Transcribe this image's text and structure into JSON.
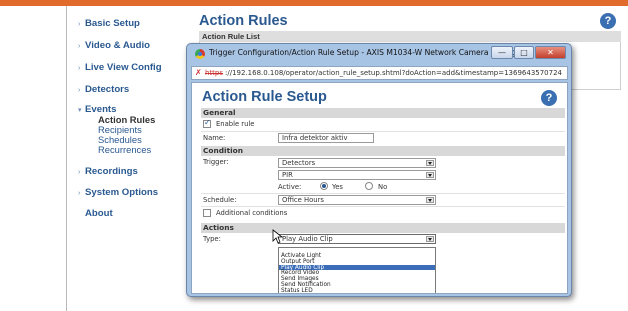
{
  "nav": {
    "items": [
      {
        "label": "Basic Setup",
        "caret": "›"
      },
      {
        "label": "Video & Audio",
        "caret": "›"
      },
      {
        "label": "Live View Config",
        "caret": "›"
      },
      {
        "label": "Detectors",
        "caret": "›"
      },
      {
        "label": "Events",
        "caret": "▾"
      },
      {
        "label": "Recordings",
        "caret": "›"
      },
      {
        "label": "System Options",
        "caret": "›"
      },
      {
        "label": "About",
        "caret": ""
      }
    ],
    "events_sub": [
      "Action Rules",
      "Recipients",
      "Schedules",
      "Recurrences"
    ]
  },
  "background": {
    "title": "Action Rules",
    "list_header": "Action Rule List",
    "help": "?"
  },
  "window": {
    "title": "Trigger Configuration/Action Rule Setup - AXIS M1034-W Network Camera - Googl...",
    "url_scheme": "https",
    "url_rest": "://192.168.0.108/operator/action_rule_setup.shtml?doAction=add&timestamp=1369643570724",
    "minimize": "—",
    "maximize": "□",
    "close": "✕"
  },
  "form": {
    "title": "Action Rule Setup",
    "help": "?",
    "general_label": "General",
    "enable_rule_label": "Enable rule",
    "enable_rule_checked": true,
    "name_label": "Name:",
    "name_value": "Infra detektor aktiv",
    "condition_label": "Condition",
    "trigger_label": "Trigger:",
    "trigger_value": "Detectors",
    "trigger_sub_value": "PIR",
    "active_label": "Active:",
    "yes_label": "Yes",
    "no_label": "No",
    "active_selected": "Yes",
    "schedule_label": "Schedule:",
    "schedule_value": "Office Hours",
    "additional_conditions_label": "Additional conditions",
    "actions_label": "Actions",
    "type_label": "Type:",
    "type_value": "Play Audio Clip",
    "type_options": [
      "Activate Light",
      "Output Port",
      "Play Audio Clip",
      "Record Video",
      "Send Images",
      "Send Notification",
      "Status LED"
    ],
    "type_selected_index": 2
  }
}
